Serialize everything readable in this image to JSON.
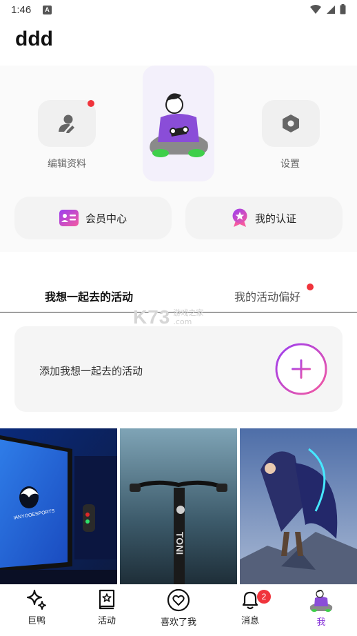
{
  "status_bar": {
    "time": "1:46",
    "notification_letter": "A"
  },
  "page_title": "ddd",
  "profile": {
    "edit_label": "编辑资料",
    "settings_label": "设置",
    "edit_has_dot": true
  },
  "pills": {
    "membership_label": "会员中心",
    "certification_label": "我的认证"
  },
  "tabs": [
    {
      "label": "我想一起去的活动",
      "active": true
    },
    {
      "label": "我的活动偏好",
      "active": false,
      "has_dot": true
    }
  ],
  "watermark": {
    "brand": "K73",
    "line1": "游戏之家",
    "line2": ".com"
  },
  "add_activity": {
    "label": "添加我想一起去的活动",
    "button_icon": "plus-icon"
  },
  "photos": [
    {
      "subject": "esports-monitor",
      "overlay_text": "IANYOOESPORTS"
    },
    {
      "subject": "bicycle-handlebars",
      "overlay_text": "TONI"
    },
    {
      "subject": "archer-character"
    }
  ],
  "bottom_nav": [
    {
      "label": "巨鸭",
      "icon": "sparkle-icon"
    },
    {
      "label": "活动",
      "icon": "star-book-icon"
    },
    {
      "label": "喜欢了我",
      "icon": "heart-circle-icon"
    },
    {
      "label": "消息",
      "icon": "bell-icon",
      "badge": "2"
    },
    {
      "label": "我",
      "icon": "avatar-icon",
      "active": true
    }
  ],
  "colors": {
    "accent": "#8b3ad9",
    "badge_red": "#f0343c",
    "gradient_start": "#9b3ef0",
    "gradient_end": "#f45aa0"
  }
}
